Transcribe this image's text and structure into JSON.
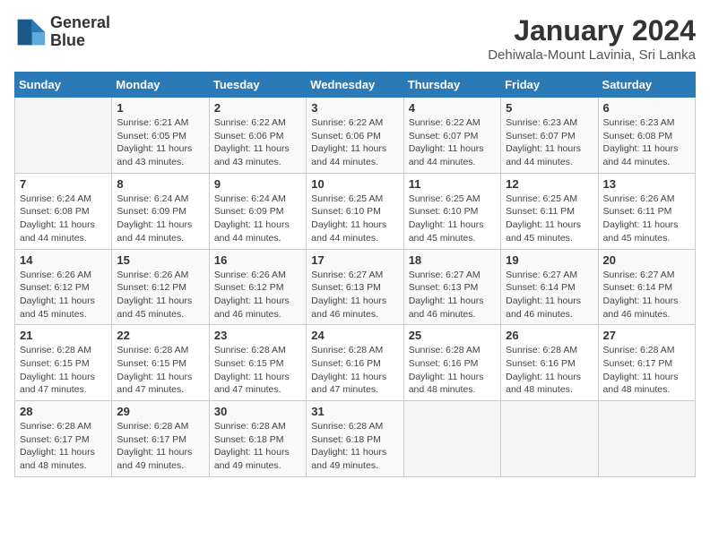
{
  "logo": {
    "line1": "General",
    "line2": "Blue"
  },
  "title": "January 2024",
  "subtitle": "Dehiwala-Mount Lavinia, Sri Lanka",
  "weekdays": [
    "Sunday",
    "Monday",
    "Tuesday",
    "Wednesday",
    "Thursday",
    "Friday",
    "Saturday"
  ],
  "weeks": [
    [
      {
        "day": "",
        "sunrise": "",
        "sunset": "",
        "daylight": ""
      },
      {
        "day": "1",
        "sunrise": "Sunrise: 6:21 AM",
        "sunset": "Sunset: 6:05 PM",
        "daylight": "Daylight: 11 hours and 43 minutes."
      },
      {
        "day": "2",
        "sunrise": "Sunrise: 6:22 AM",
        "sunset": "Sunset: 6:06 PM",
        "daylight": "Daylight: 11 hours and 43 minutes."
      },
      {
        "day": "3",
        "sunrise": "Sunrise: 6:22 AM",
        "sunset": "Sunset: 6:06 PM",
        "daylight": "Daylight: 11 hours and 44 minutes."
      },
      {
        "day": "4",
        "sunrise": "Sunrise: 6:22 AM",
        "sunset": "Sunset: 6:07 PM",
        "daylight": "Daylight: 11 hours and 44 minutes."
      },
      {
        "day": "5",
        "sunrise": "Sunrise: 6:23 AM",
        "sunset": "Sunset: 6:07 PM",
        "daylight": "Daylight: 11 hours and 44 minutes."
      },
      {
        "day": "6",
        "sunrise": "Sunrise: 6:23 AM",
        "sunset": "Sunset: 6:08 PM",
        "daylight": "Daylight: 11 hours and 44 minutes."
      }
    ],
    [
      {
        "day": "7",
        "sunrise": "Sunrise: 6:24 AM",
        "sunset": "Sunset: 6:08 PM",
        "daylight": "Daylight: 11 hours and 44 minutes."
      },
      {
        "day": "8",
        "sunrise": "Sunrise: 6:24 AM",
        "sunset": "Sunset: 6:09 PM",
        "daylight": "Daylight: 11 hours and 44 minutes."
      },
      {
        "day": "9",
        "sunrise": "Sunrise: 6:24 AM",
        "sunset": "Sunset: 6:09 PM",
        "daylight": "Daylight: 11 hours and 44 minutes."
      },
      {
        "day": "10",
        "sunrise": "Sunrise: 6:25 AM",
        "sunset": "Sunset: 6:10 PM",
        "daylight": "Daylight: 11 hours and 44 minutes."
      },
      {
        "day": "11",
        "sunrise": "Sunrise: 6:25 AM",
        "sunset": "Sunset: 6:10 PM",
        "daylight": "Daylight: 11 hours and 45 minutes."
      },
      {
        "day": "12",
        "sunrise": "Sunrise: 6:25 AM",
        "sunset": "Sunset: 6:11 PM",
        "daylight": "Daylight: 11 hours and 45 minutes."
      },
      {
        "day": "13",
        "sunrise": "Sunrise: 6:26 AM",
        "sunset": "Sunset: 6:11 PM",
        "daylight": "Daylight: 11 hours and 45 minutes."
      }
    ],
    [
      {
        "day": "14",
        "sunrise": "Sunrise: 6:26 AM",
        "sunset": "Sunset: 6:12 PM",
        "daylight": "Daylight: 11 hours and 45 minutes."
      },
      {
        "day": "15",
        "sunrise": "Sunrise: 6:26 AM",
        "sunset": "Sunset: 6:12 PM",
        "daylight": "Daylight: 11 hours and 45 minutes."
      },
      {
        "day": "16",
        "sunrise": "Sunrise: 6:26 AM",
        "sunset": "Sunset: 6:12 PM",
        "daylight": "Daylight: 11 hours and 46 minutes."
      },
      {
        "day": "17",
        "sunrise": "Sunrise: 6:27 AM",
        "sunset": "Sunset: 6:13 PM",
        "daylight": "Daylight: 11 hours and 46 minutes."
      },
      {
        "day": "18",
        "sunrise": "Sunrise: 6:27 AM",
        "sunset": "Sunset: 6:13 PM",
        "daylight": "Daylight: 11 hours and 46 minutes."
      },
      {
        "day": "19",
        "sunrise": "Sunrise: 6:27 AM",
        "sunset": "Sunset: 6:14 PM",
        "daylight": "Daylight: 11 hours and 46 minutes."
      },
      {
        "day": "20",
        "sunrise": "Sunrise: 6:27 AM",
        "sunset": "Sunset: 6:14 PM",
        "daylight": "Daylight: 11 hours and 46 minutes."
      }
    ],
    [
      {
        "day": "21",
        "sunrise": "Sunrise: 6:28 AM",
        "sunset": "Sunset: 6:15 PM",
        "daylight": "Daylight: 11 hours and 47 minutes."
      },
      {
        "day": "22",
        "sunrise": "Sunrise: 6:28 AM",
        "sunset": "Sunset: 6:15 PM",
        "daylight": "Daylight: 11 hours and 47 minutes."
      },
      {
        "day": "23",
        "sunrise": "Sunrise: 6:28 AM",
        "sunset": "Sunset: 6:15 PM",
        "daylight": "Daylight: 11 hours and 47 minutes."
      },
      {
        "day": "24",
        "sunrise": "Sunrise: 6:28 AM",
        "sunset": "Sunset: 6:16 PM",
        "daylight": "Daylight: 11 hours and 47 minutes."
      },
      {
        "day": "25",
        "sunrise": "Sunrise: 6:28 AM",
        "sunset": "Sunset: 6:16 PM",
        "daylight": "Daylight: 11 hours and 48 minutes."
      },
      {
        "day": "26",
        "sunrise": "Sunrise: 6:28 AM",
        "sunset": "Sunset: 6:16 PM",
        "daylight": "Daylight: 11 hours and 48 minutes."
      },
      {
        "day": "27",
        "sunrise": "Sunrise: 6:28 AM",
        "sunset": "Sunset: 6:17 PM",
        "daylight": "Daylight: 11 hours and 48 minutes."
      }
    ],
    [
      {
        "day": "28",
        "sunrise": "Sunrise: 6:28 AM",
        "sunset": "Sunset: 6:17 PM",
        "daylight": "Daylight: 11 hours and 48 minutes."
      },
      {
        "day": "29",
        "sunrise": "Sunrise: 6:28 AM",
        "sunset": "Sunset: 6:17 PM",
        "daylight": "Daylight: 11 hours and 49 minutes."
      },
      {
        "day": "30",
        "sunrise": "Sunrise: 6:28 AM",
        "sunset": "Sunset: 6:18 PM",
        "daylight": "Daylight: 11 hours and 49 minutes."
      },
      {
        "day": "31",
        "sunrise": "Sunrise: 6:28 AM",
        "sunset": "Sunset: 6:18 PM",
        "daylight": "Daylight: 11 hours and 49 minutes."
      },
      {
        "day": "",
        "sunrise": "",
        "sunset": "",
        "daylight": ""
      },
      {
        "day": "",
        "sunrise": "",
        "sunset": "",
        "daylight": ""
      },
      {
        "day": "",
        "sunrise": "",
        "sunset": "",
        "daylight": ""
      }
    ]
  ]
}
